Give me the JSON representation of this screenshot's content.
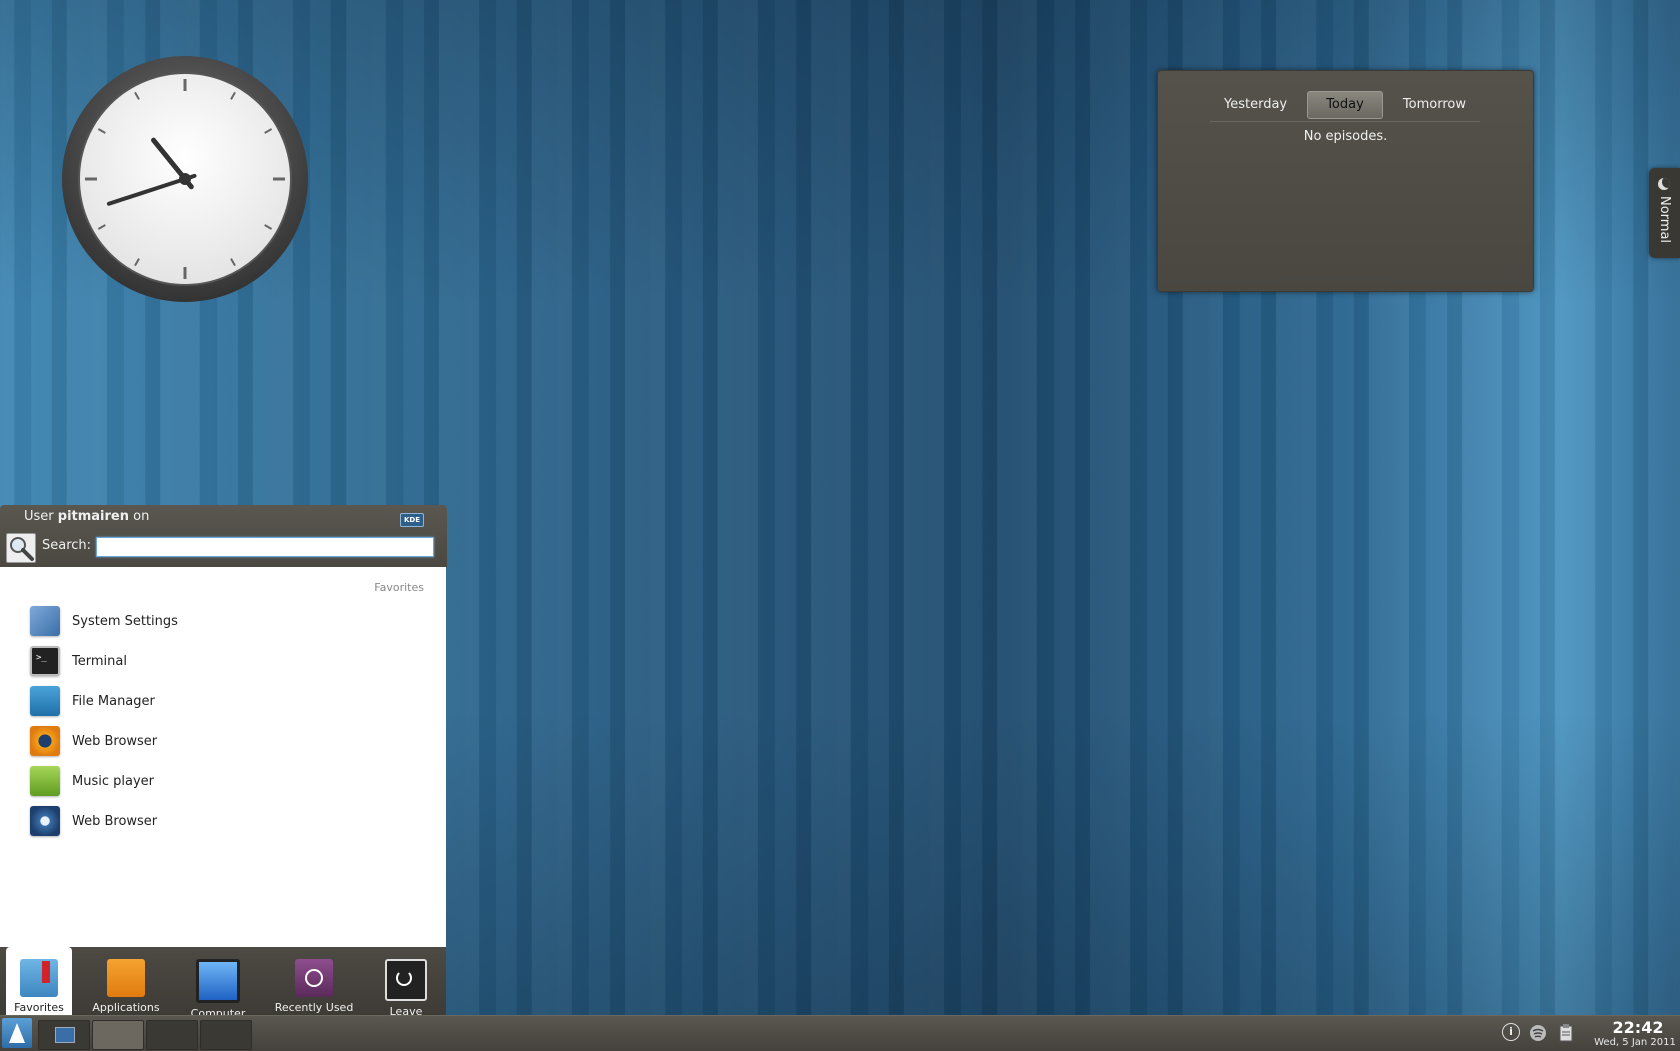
{
  "episodes_widget": {
    "tabs": [
      {
        "label": "Yesterday",
        "active": false
      },
      {
        "label": "Today",
        "active": true
      },
      {
        "label": "Tomorrow",
        "active": false
      }
    ],
    "empty_text": "No episodes."
  },
  "activity": {
    "label": "Normal",
    "icon": "moon-icon"
  },
  "clock": {
    "hour": 22,
    "minute": 42
  },
  "launcher": {
    "user_prefix": "User ",
    "username": "pitmairen",
    "user_suffix": " on",
    "kde_badge": "KDE",
    "search_label": "Search:",
    "search_value": "",
    "section_label": "Favorites",
    "favorites": [
      {
        "label": "System Settings",
        "icon": "wrench-settings-icon"
      },
      {
        "label": "Terminal",
        "icon": "terminal-icon"
      },
      {
        "label": "File Manager",
        "icon": "file-manager-icon"
      },
      {
        "label": "Web Browser",
        "icon": "web-browser-eye-icon"
      },
      {
        "label": "Music player",
        "icon": "spotify-icon"
      },
      {
        "label": "Web Browser",
        "icon": "web-browser-globe-icon"
      }
    ],
    "tabs": [
      {
        "label": "Favorites",
        "icon": "favorites-bookmark-icon",
        "active": true
      },
      {
        "label": "Applications",
        "icon": "applications-icon",
        "active": false
      },
      {
        "label": "Computer",
        "icon": "computer-icon",
        "active": false
      },
      {
        "label": "Recently Used",
        "icon": "recently-used-icon",
        "active": false
      },
      {
        "label": "Leave",
        "icon": "leave-power-icon",
        "active": false
      }
    ]
  },
  "taskbar": {
    "tray_icons": [
      "info-icon",
      "network-icon",
      "clipboard-icon"
    ],
    "info_glyph": "i",
    "time": "22:42",
    "date": "Wed, 5 Jan 2011"
  },
  "colors": {
    "desktop_blue": "#2f6c95",
    "widget_bg": "#4e4b45",
    "accent": "#6aa6d8"
  }
}
